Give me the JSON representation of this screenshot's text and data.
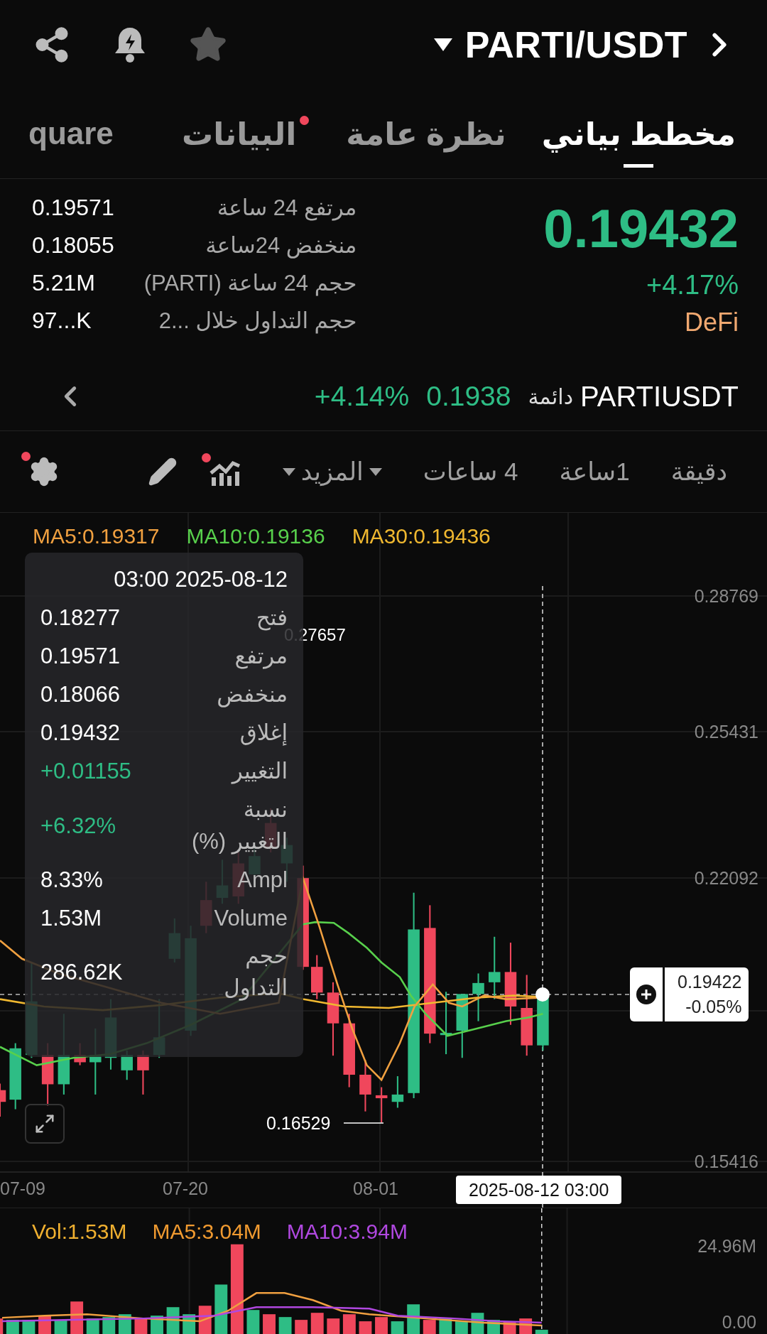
{
  "header": {
    "title": "PARTI/USDT"
  },
  "tabs": [
    {
      "label": "مخطط بياني",
      "selected": true,
      "badge": false
    },
    {
      "label": "نظرة عامة",
      "selected": false,
      "badge": false
    },
    {
      "label": "البيانات",
      "selected": false,
      "badge": true
    },
    {
      "label": "quare",
      "selected": false,
      "badge": false
    }
  ],
  "stats": [
    {
      "label": "مرتفع 24 ساعة",
      "value": "0.19571"
    },
    {
      "label": "منخفض 24ساعة",
      "value": "0.18055"
    },
    {
      "label": "حجم 24 ساعة (PARTI)",
      "value": "5.21M"
    },
    {
      "label": "حجم التداول خلال ...2",
      "value": "97...K"
    }
  ],
  "price": {
    "last": "0.19432",
    "change": "+4.17%",
    "sector": "DeFi"
  },
  "perpetual": {
    "symbol": "PARTIUSDT",
    "tag": "دائمة",
    "price": "0.1938",
    "change": "+4.14%"
  },
  "toolbar": {
    "intervals": [
      {
        "label": "دقيقة",
        "selected": false
      },
      {
        "label": "1ساعة",
        "selected": false
      },
      {
        "label": "4 ساعات",
        "selected": false
      }
    ],
    "more": "المزيد",
    "indicator_badge": true,
    "settings_badge": true
  },
  "chart": {
    "legend": [
      {
        "text": "MA30:0.19436",
        "color": "#f0b830"
      },
      {
        "text": "MA10:0.19136",
        "color": "#58d04c"
      },
      {
        "text": "MA5:0.19317",
        "color": "#f0a040"
      }
    ],
    "y_labels": [
      "0.28769",
      "0.25431",
      "0.22092",
      "0.15416"
    ],
    "high_mark": "0.27657",
    "low_mark": "0.16529",
    "x_labels": [
      "08-01",
      "07-20",
      "07-09"
    ],
    "cursor_time": "2025-08-12 03:00",
    "cursor_price": "0.19422",
    "cursor_change": "-0.05%",
    "tooltip": {
      "time": "03:00 2025-08-12",
      "rows": [
        {
          "label": "فتح",
          "value": "0.18277",
          "kind": "plain"
        },
        {
          "label": "مرتفع",
          "value": "0.19571",
          "kind": "plain"
        },
        {
          "label": "منخفض",
          "value": "0.18066",
          "kind": "plain"
        },
        {
          "label": "إغلاق",
          "value": "0.19432",
          "kind": "plain"
        },
        {
          "label": "التغيير",
          "value": "+0.01155",
          "kind": "up"
        },
        {
          "label": "نسبة التغيير (%)",
          "value": "+6.32%",
          "kind": "up"
        },
        {
          "label": "Ampl",
          "value": "8.33%",
          "kind": "plain"
        },
        {
          "label": "Volume",
          "value": "1.53M",
          "kind": "plain"
        },
        {
          "label": "حجم التداول",
          "value": "286.62K",
          "kind": "plain"
        }
      ]
    }
  },
  "volume": {
    "legend": [
      {
        "text": "MA10:3.94M",
        "color": "#b048e0"
      },
      {
        "text": "MA5:3.04M",
        "color": "#f09a30"
      },
      {
        "text": "Vol:1.53M",
        "color": "#f0b030"
      }
    ],
    "y_labels": [
      "24.96M",
      "0.00"
    ]
  }
}
